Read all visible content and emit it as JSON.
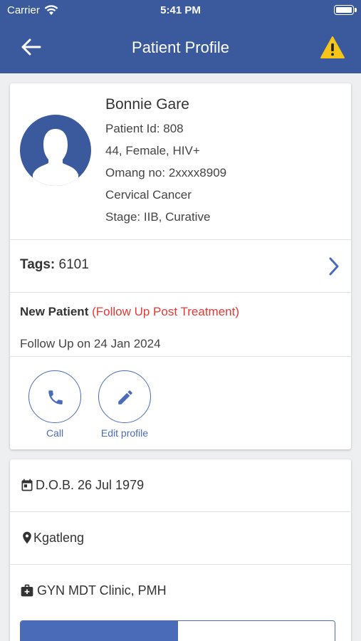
{
  "status_bar": {
    "carrier": "Carrier",
    "time": "5:41 PM"
  },
  "header": {
    "title": "Patient Profile"
  },
  "patient": {
    "name": "Bonnie Gare",
    "id_line": "Patient Id: 808",
    "demographics": "44, Female, HIV+",
    "omang": "Omang no: 2xxxx8909",
    "diagnosis": "Cervical Cancer",
    "stage": "Stage: IIB, Curative"
  },
  "tags": {
    "label": "Tags:",
    "value": "6101"
  },
  "visit": {
    "type": "New Patient",
    "reason": "(Follow Up Post Treatment)",
    "follow_up": "Follow Up on 24 Jan 2024"
  },
  "actions": {
    "call_label": "Call",
    "edit_label": "Edit profile"
  },
  "details": {
    "dob": "D.O.B. 26 Jul 1979",
    "location": "Kgatleng",
    "clinic": "GYN MDT Clinic, PMH"
  },
  "colors": {
    "primary": "#3b5a9e",
    "accent": "#4a6cb8",
    "warning": "#f5c518",
    "alert_text": "#e53935"
  }
}
